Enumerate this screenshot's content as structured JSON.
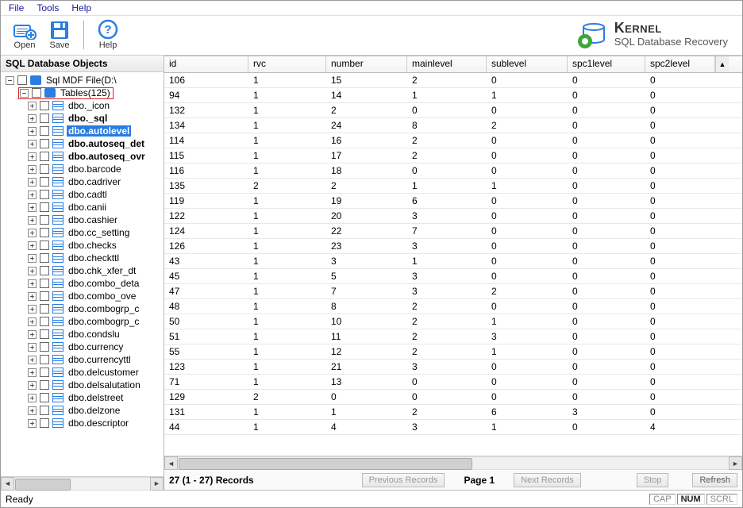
{
  "menu": {
    "file": "File",
    "tools": "Tools",
    "help": "Help"
  },
  "toolbar": {
    "open": "Open",
    "save": "Save",
    "help": "Help"
  },
  "brand": {
    "name": "Kernel",
    "sub": "SQL Database Recovery"
  },
  "sidebar": {
    "title": "SQL Database Objects",
    "root": "Sql MDF File(D:\\",
    "folder": "Tables(125)",
    "tables": [
      "dbo._icon",
      "dbo._sql",
      "dbo.autolevel",
      "dbo.autoseq_det",
      "dbo.autoseq_ovr",
      "dbo.barcode",
      "dbo.cadriver",
      "dbo.cadtl",
      "dbo.canii",
      "dbo.cashier",
      "dbo.cc_setting",
      "dbo.checks",
      "dbo.checkttl",
      "dbo.chk_xfer_dt",
      "dbo.combo_deta",
      "dbo.combo_ove",
      "dbo.combogrp_c",
      "dbo.combogrp_c",
      "dbo.condslu",
      "dbo.currency",
      "dbo.currencyttl",
      "dbo.delcustomer",
      "dbo.delsalutation",
      "dbo.delstreet",
      "dbo.delzone",
      "dbo.descriptor"
    ],
    "selected_index": 2,
    "bold_indices": [
      1,
      2,
      3,
      4
    ]
  },
  "grid": {
    "columns": [
      "id",
      "rvc",
      "number",
      "mainlevel",
      "sublevel",
      "spc1level",
      "spc2level"
    ],
    "rows": [
      [
        106,
        1,
        15,
        2,
        0,
        0,
        0
      ],
      [
        94,
        1,
        14,
        1,
        1,
        0,
        0
      ],
      [
        132,
        1,
        2,
        0,
        0,
        0,
        0
      ],
      [
        134,
        1,
        24,
        8,
        2,
        0,
        0
      ],
      [
        114,
        1,
        16,
        2,
        0,
        0,
        0
      ],
      [
        115,
        1,
        17,
        2,
        0,
        0,
        0
      ],
      [
        116,
        1,
        18,
        0,
        0,
        0,
        0
      ],
      [
        135,
        2,
        2,
        1,
        1,
        0,
        0
      ],
      [
        119,
        1,
        19,
        6,
        0,
        0,
        0
      ],
      [
        122,
        1,
        20,
        3,
        0,
        0,
        0
      ],
      [
        124,
        1,
        22,
        7,
        0,
        0,
        0
      ],
      [
        126,
        1,
        23,
        3,
        0,
        0,
        0
      ],
      [
        43,
        1,
        3,
        1,
        0,
        0,
        0
      ],
      [
        45,
        1,
        5,
        3,
        0,
        0,
        0
      ],
      [
        47,
        1,
        7,
        3,
        2,
        0,
        0
      ],
      [
        48,
        1,
        8,
        2,
        0,
        0,
        0
      ],
      [
        50,
        1,
        10,
        2,
        1,
        0,
        0
      ],
      [
        51,
        1,
        11,
        2,
        3,
        0,
        0
      ],
      [
        55,
        1,
        12,
        2,
        1,
        0,
        0
      ],
      [
        123,
        1,
        21,
        3,
        0,
        0,
        0
      ],
      [
        71,
        1,
        13,
        0,
        0,
        0,
        0
      ],
      [
        129,
        2,
        0,
        0,
        0,
        0,
        0
      ],
      [
        131,
        1,
        1,
        2,
        6,
        3,
        0
      ],
      [
        44,
        1,
        4,
        3,
        1,
        0,
        4
      ]
    ]
  },
  "footer": {
    "count": "27 (1 - 27) Records",
    "prev": "Previous Records",
    "page": "Page 1",
    "next": "Next Records",
    "stop": "Stop",
    "refresh": "Refresh"
  },
  "status": {
    "ready": "Ready",
    "cap": "CAP",
    "num": "NUM",
    "scrl": "SCRL"
  }
}
